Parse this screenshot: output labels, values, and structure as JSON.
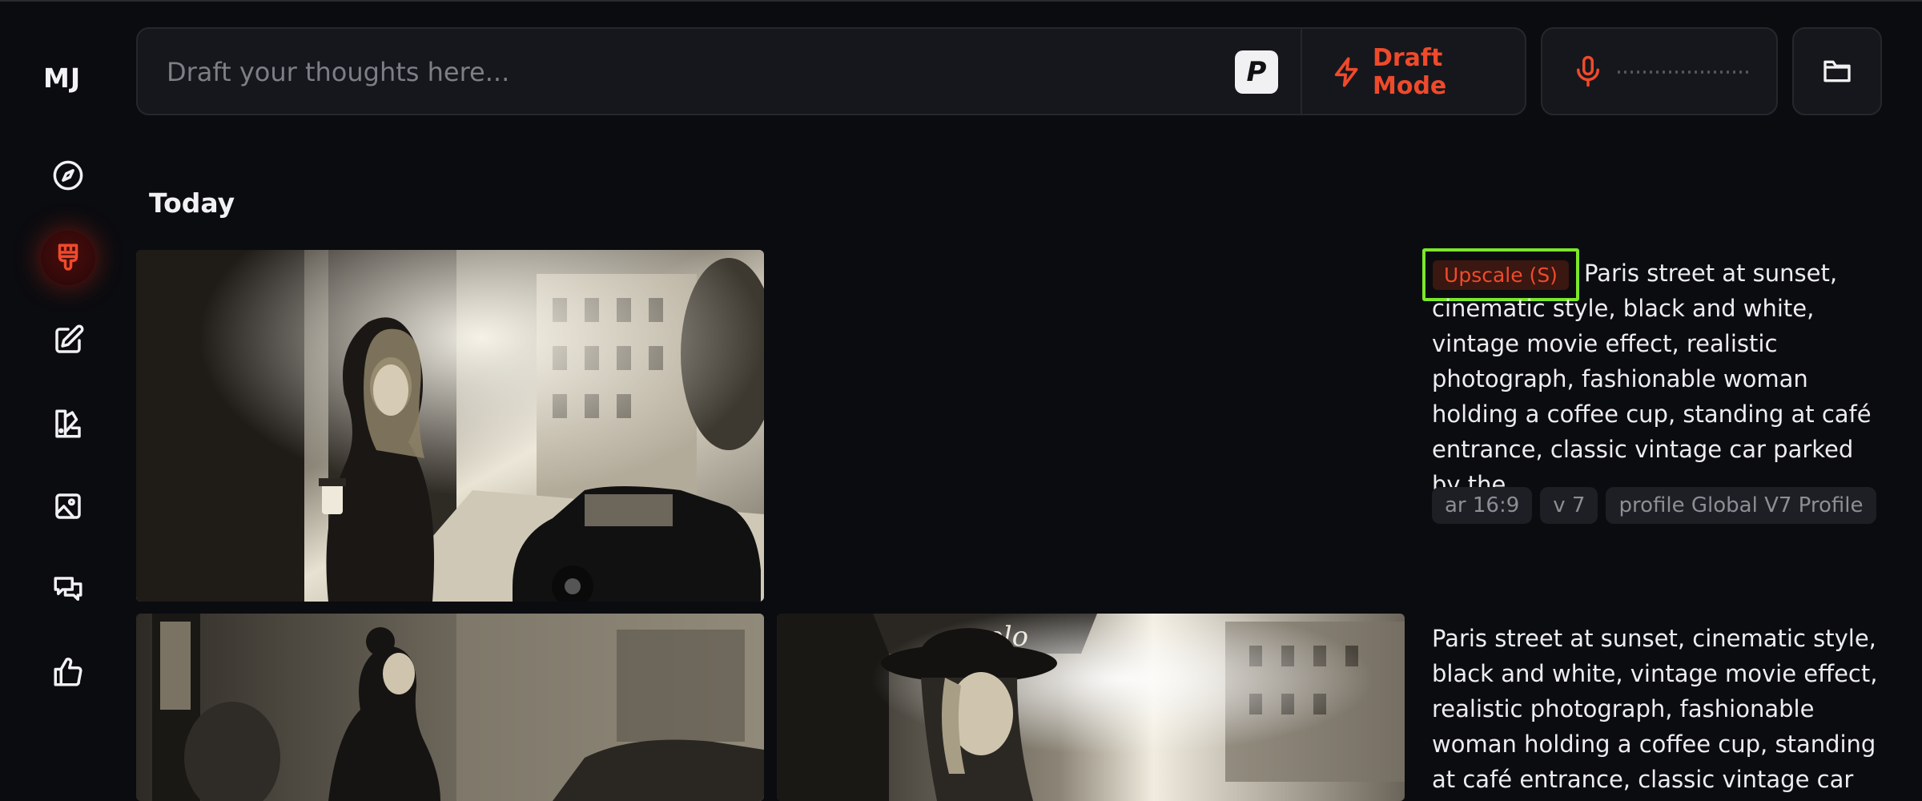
{
  "app": {
    "logo": "MJ"
  },
  "sidebar": {
    "items": [
      {
        "name": "explore",
        "icon": "compass-icon"
      },
      {
        "name": "create",
        "icon": "paintbrush-icon",
        "active": true
      },
      {
        "name": "edit",
        "icon": "edit-icon"
      },
      {
        "name": "personalize",
        "icon": "palette-icon"
      },
      {
        "name": "organize",
        "icon": "image-icon"
      },
      {
        "name": "chat",
        "icon": "chat-icon"
      },
      {
        "name": "rate",
        "icon": "thumbs-up-icon"
      }
    ]
  },
  "prompt_bar": {
    "placeholder": "Draft your thoughts here...",
    "value": "",
    "p_badge": "P",
    "draft_mode_label": "Draft Mode",
    "draft_mode_icon": "lightning-icon",
    "accent_color": "#ef4a2b"
  },
  "voice": {
    "icon": "microphone-icon"
  },
  "folder": {
    "icon": "folder-icon"
  },
  "feed": {
    "section_title": "Today",
    "jobs": [
      {
        "tag": "Upscale (S)",
        "prompt_text": "Paris street at sunset, cinematic style, black and white, vintage movie effect, realistic photograph, fashionable woman holding a coffee cup, standing at café entrance, classic vintage car parked by the…",
        "params": [
          "ar 16:9",
          "v 7",
          "profile Global V7 Profile"
        ]
      },
      {
        "prompt_text": "Paris street at sunset, cinematic style, black and white, vintage movie effect, realistic photograph, fashionable woman holding a coffee cup, standing at café entrance, classic vintage car",
        "image_signage": "opolo"
      }
    ]
  }
}
